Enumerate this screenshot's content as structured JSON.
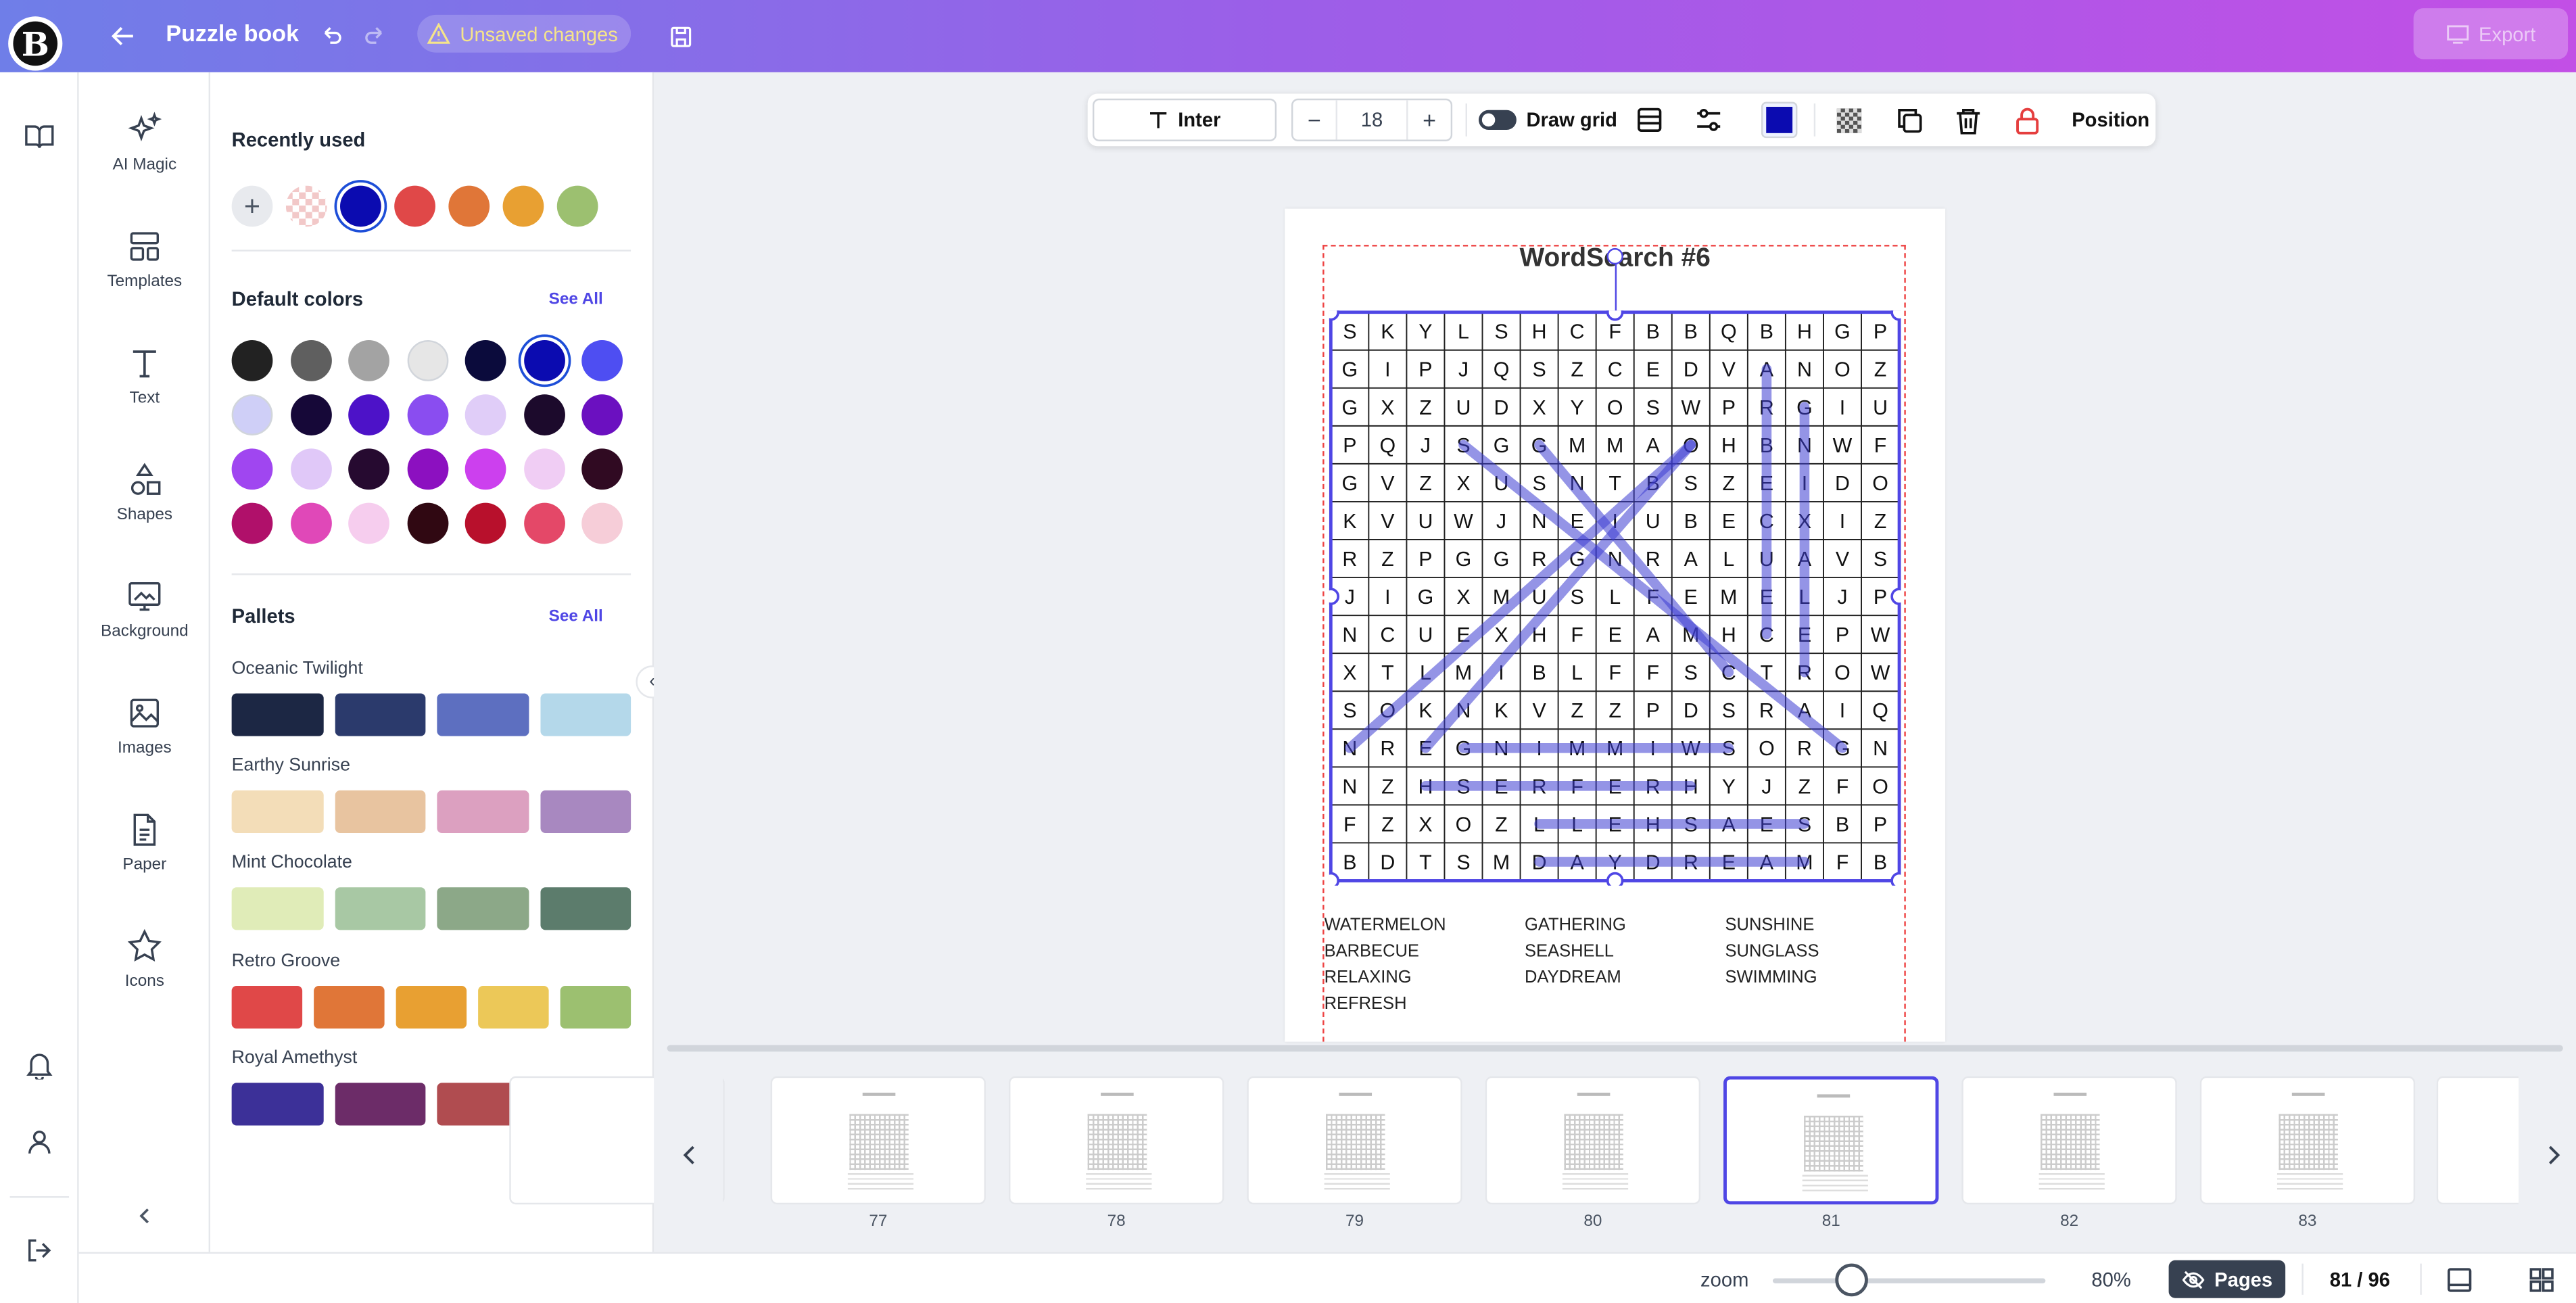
{
  "header": {
    "title": "Puzzle book",
    "unsaved_label": "Unsaved changes",
    "export_label": "Export"
  },
  "tools": [
    {
      "label": "AI Magic",
      "icon": "sparkles-icon"
    },
    {
      "label": "Templates",
      "icon": "templates-icon"
    },
    {
      "label": "Text",
      "icon": "text-icon"
    },
    {
      "label": "Shapes",
      "icon": "shapes-icon"
    },
    {
      "label": "Background",
      "icon": "background-icon"
    },
    {
      "label": "Images",
      "icon": "image-icon"
    },
    {
      "label": "Paper",
      "icon": "paper-icon"
    },
    {
      "label": "Icons",
      "icon": "star-icon"
    }
  ],
  "panel": {
    "recent_title": "Recently used",
    "recent_colors": [
      "#0b0bb0",
      "#e04848",
      "#e07638",
      "#e8a032",
      "#9cc070"
    ],
    "default_title": "Default colors",
    "see_all": "See All",
    "default_colors": [
      "#222222",
      "#5f5f5f",
      "#a3a3a3",
      "#e6e6e6",
      "#0b0b3c",
      "#0b0bb0",
      "#4e4ef2",
      "#cfcff7",
      "#160838",
      "#4d12c8",
      "#8a4df0",
      "#e0cdf8",
      "#1c0a2c",
      "#6b10c0",
      "#a046f0",
      "#e0c8f8",
      "#260a30",
      "#8c10c0",
      "#cc40ee",
      "#f0cdf4",
      "#300a22",
      "#b0106a",
      "#e048b8",
      "#f6cdee",
      "#300812",
      "#b8102c",
      "#e44868",
      "#f6cdd8"
    ],
    "pallets_title": "Pallets",
    "pallets": [
      {
        "name": "Oceanic Twilight",
        "colors": [
          "#1c2744",
          "#2b3a6c",
          "#5d6fc0",
          "#b4d8ea"
        ]
      },
      {
        "name": "Earthy Sunrise",
        "colors": [
          "#f3ddb8",
          "#e8c4a0",
          "#dca0c0",
          "#a888c0"
        ]
      },
      {
        "name": "Mint Chocolate",
        "colors": [
          "#e0ecb8",
          "#a8c8a4",
          "#8ca888",
          "#5c7c6c"
        ]
      },
      {
        "name": "Retro Groove",
        "colors": [
          "#e04848",
          "#e07638",
          "#e8a032",
          "#ecc858",
          "#9cc070"
        ]
      },
      {
        "name": "Royal Amethyst",
        "colors": [
          "#3c3098",
          "#6c2c68",
          "#b04c50",
          "#dc9690"
        ]
      }
    ]
  },
  "toolbar": {
    "font": "Inter",
    "font_size": "18",
    "draw_grid_label": "Draw grid",
    "active_color": "#0b0bb0",
    "position_label": "Position"
  },
  "puzzle": {
    "title": "WordSearch #6",
    "grid": [
      "SKYLSHCFBBQBHGP",
      "GIPJQSZCEDVANOZ",
      "GXZUDXYOSWPRGIU",
      "PQJSGGMMAOHBNWF",
      "GVZXUSNTBSZEIDO",
      "KVUWJNEIUBECXIZ",
      "RZPGGRGNRALUAVS",
      "JIGXMUSLFEMELJP",
      "NCUEXHFEAMHCEPW",
      "XTLMIBLFFSCTROW",
      "SOKNKVZZPDSRAIQ",
      "NREGNIMMIWSORGN",
      "NZHSERFERHYJZFO",
      "FZXOZLLEHSAESBP",
      "BDTSMDAYDREAMFB"
    ],
    "words_col1": [
      "WATERMELON",
      "BARBECUE",
      "RELAXING",
      "REFRESH"
    ],
    "words_col2": [
      "GATHERING",
      "SEASHELL",
      "DAYDREAM"
    ],
    "words_col3": [
      "SUNSHINE",
      "SUNGLASS",
      "SWIMMING"
    ]
  },
  "thumbnails": [
    "77",
    "78",
    "79",
    "80",
    "81",
    "82",
    "83"
  ],
  "selected_thumbnail": "81",
  "status": {
    "zoom_label": "zoom",
    "zoom_value": "80%",
    "pages_label": "Pages",
    "page_count": "81 / 96"
  }
}
